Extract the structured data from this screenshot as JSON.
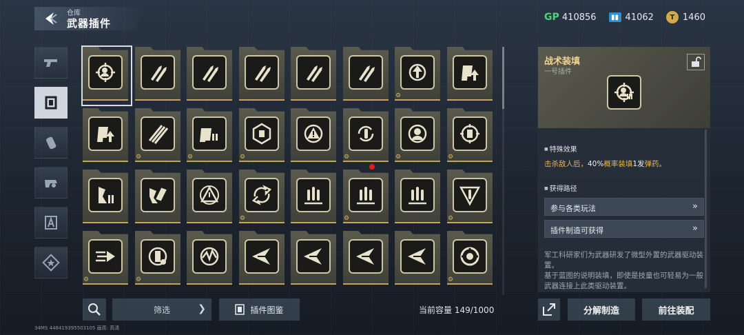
{
  "header": {
    "breadcrumb": "仓库",
    "title": "武器插件"
  },
  "currencies": [
    {
      "icon": "gp-icon",
      "label": "GP",
      "value": "410856"
    },
    {
      "icon": "ticket-icon",
      "label": "",
      "value": "41062"
    },
    {
      "icon": "coin-icon",
      "label": "",
      "value": "1460"
    }
  ],
  "side_tabs": [
    {
      "icon": "pistol-icon",
      "active": false
    },
    {
      "icon": "plugin-chip-icon",
      "active": true
    },
    {
      "icon": "grenade-icon",
      "active": false
    },
    {
      "icon": "gear-module-icon",
      "active": false
    },
    {
      "icon": "armor-letter-icon",
      "active": false
    },
    {
      "icon": "star-badge-icon",
      "active": false
    }
  ],
  "plugins": [
    {
      "icon": "tactical-reload-icon",
      "star": false,
      "selected": true
    },
    {
      "icon": "bullets-icon",
      "star": false
    },
    {
      "icon": "bullets-icon",
      "star": false
    },
    {
      "icon": "bullets-icon",
      "star": false
    },
    {
      "icon": "bullets-icon",
      "star": false
    },
    {
      "icon": "bullets-icon",
      "star": false
    },
    {
      "icon": "target-arrow-icon",
      "star": true
    },
    {
      "icon": "magazine-up-icon",
      "star": false
    },
    {
      "icon": "magazine-up-icon",
      "star": false
    },
    {
      "icon": "ammo-belt-icon",
      "star": true
    },
    {
      "icon": "magazine-stack-icon",
      "star": true
    },
    {
      "icon": "hex-core-icon",
      "star": true
    },
    {
      "icon": "warning-icon",
      "star": false
    },
    {
      "icon": "cycle-bullet-icon",
      "star": true
    },
    {
      "icon": "headshot-icon",
      "star": true
    },
    {
      "icon": "target-mag-icon",
      "star": true
    },
    {
      "icon": "shard-mag-icon",
      "star": false
    },
    {
      "icon": "explode-mag-icon",
      "star": false
    },
    {
      "icon": "triangle-alert-icon",
      "star": false
    },
    {
      "icon": "reload-arrows-icon",
      "star": true
    },
    {
      "icon": "triple-bullet-icon",
      "star": false
    },
    {
      "icon": "triple-bullet-icon",
      "star": true
    },
    {
      "icon": "triple-bullet-icon",
      "star": false
    },
    {
      "icon": "triangle-bullet-icon",
      "star": true
    },
    {
      "icon": "speed-bullet-icon",
      "star": true
    },
    {
      "icon": "gear-mag-icon",
      "star": true
    },
    {
      "icon": "burst-mag-icon",
      "star": false
    },
    {
      "icon": "winged-arrow-icon",
      "star": false
    },
    {
      "icon": "winged-arrow-icon",
      "star": false
    },
    {
      "icon": "winged-arrow-icon",
      "star": false
    },
    {
      "icon": "winged-arrow-icon",
      "star": false
    },
    {
      "icon": "cycle-core-icon",
      "star": true
    }
  ],
  "bottom": {
    "filter_label": "筛选",
    "gallery_label": "插件图鉴",
    "capacity_label": "当前容量",
    "capacity_value": "149/1000",
    "device_id": "34MS  448419395503105    画质: 高清"
  },
  "detail": {
    "title": "战术装填",
    "subtitle": "一号插件",
    "effect_header": "特殊效果",
    "effect_parts": [
      "击杀敌人后，",
      "40%",
      "概率装填",
      "1发",
      "弹药。"
    ],
    "acquire_header": "获得路径",
    "routes": [
      "参与各类玩法",
      "插件制造可获得"
    ],
    "description": "军工科研家们为武器研发了微型外置的武器驱动装置。\n基于蓝图的说明装填，即使是技童也可轻易为一般武器连接上此类驱动装置。"
  },
  "actions": {
    "dismantle": "分解制造",
    "goto_equip": "前往装配"
  },
  "colors": {
    "accent_gold": "#e0b850",
    "frame": "#5a5a4e",
    "panel": "#262f3a",
    "notify": "#e02020"
  }
}
